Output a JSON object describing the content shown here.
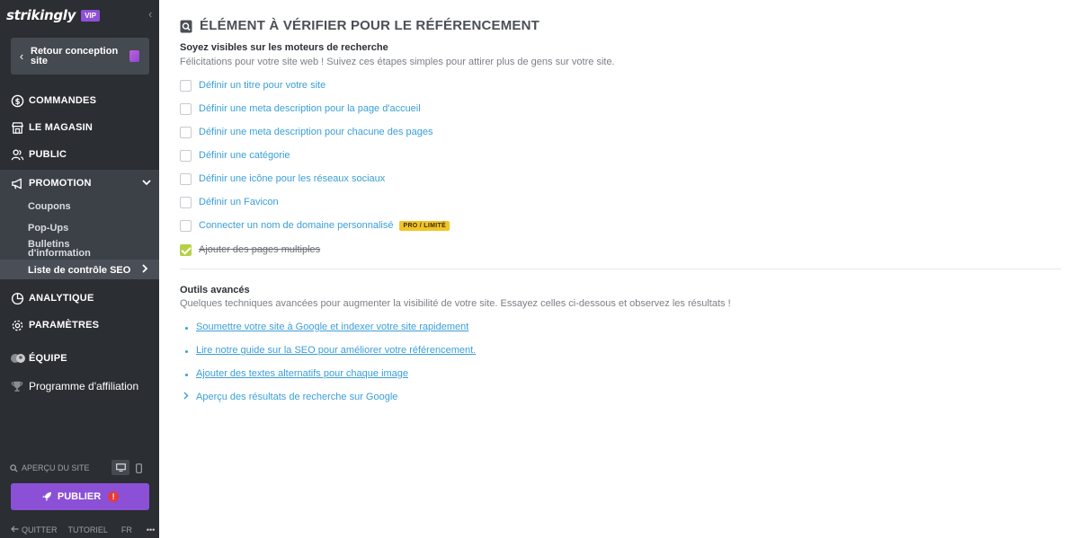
{
  "sidebar": {
    "brand": "strikingly",
    "vip": "VIP",
    "back_button": "Retour conception site",
    "nav": {
      "commandes": "COMMANDES",
      "magasin": "LE MAGASIN",
      "public": "PUBLIC",
      "promotion": "PROMOTION",
      "analytique": "ANALYTIQUE",
      "parametres": "PARAMÈTRES",
      "equipe": "ÉQUIPE",
      "affiliation": "Programme d'affiliation"
    },
    "promotion_items": {
      "coupons": "Coupons",
      "popups": "Pop-Ups",
      "bulletins_1": "Bulletins",
      "bulletins_2": "d'information",
      "seo": "Liste de contrôle SEO"
    },
    "preview_label": "APERÇU DU SITE",
    "publish": "PUBLIER",
    "publish_alert": "!",
    "footer": {
      "quit": "QUITTER",
      "tutorial": "TUTORIEL",
      "lang": "FR",
      "more": "•••"
    }
  },
  "main": {
    "title": "ÉLÉMENT À VÉRIFIER POUR LE RÉFÉRENCEMENT",
    "visibility": {
      "heading": "Soyez visibles sur les moteurs de recherche",
      "subtitle": "Félicitations pour votre site web ! Suivez ces étapes simples pour attirer plus de gens sur votre site.",
      "items": [
        {
          "label": "Définir un titre pour votre site",
          "checked": false
        },
        {
          "label": "Définir une meta description pour la page d'accueil",
          "checked": false
        },
        {
          "label": "Définir une meta description pour chacune des pages",
          "checked": false
        },
        {
          "label": "Définir une catégorie",
          "checked": false
        },
        {
          "label": "Définir une icône pour les réseaux sociaux",
          "checked": false
        },
        {
          "label": "Définir un Favicon",
          "checked": false
        },
        {
          "label": "Connecter un nom de domaine personnalisé",
          "checked": false,
          "badge": "PRO / LIMITÉ"
        },
        {
          "label": "Ajouter des pages multiples",
          "checked": true
        }
      ]
    },
    "advanced": {
      "heading": "Outils avancés",
      "subtitle": "Quelques techniques avancées pour augmenter la visibilité de votre site. Essayez celles ci-dessous et observez les résultats !",
      "links": [
        "Soumettre votre site à Google et indexer votre site rapidement",
        "Lire notre guide sur la SEO pour améliorer votre référencement.",
        "Ajouter des textes alternatifs pour chaque image"
      ],
      "serp_preview": "Aperçu des résultats de recherche sur Google"
    }
  },
  "colors": {
    "sidebar_bg": "#2b2e33",
    "accent_purple": "#8b50d6",
    "link_blue": "#3a9fd8",
    "check_green": "#b6d045",
    "badge_yellow": "#f2c428"
  }
}
